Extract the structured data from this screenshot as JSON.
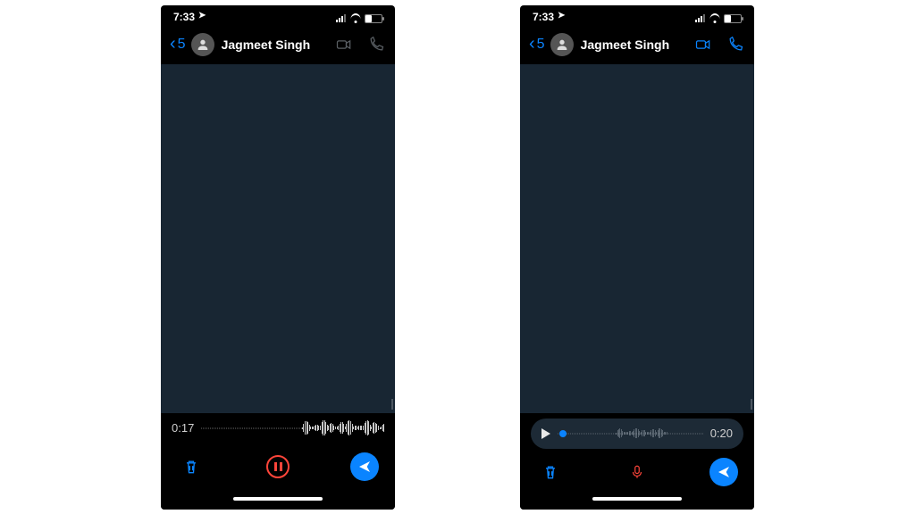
{
  "status": {
    "time": "7:33"
  },
  "header": {
    "back_count": "5",
    "contact_name": "Jagmeet Singh"
  },
  "phoneA": {
    "recording_time": "0:17"
  },
  "phoneB": {
    "recording_time": "0:20"
  },
  "colors": {
    "accent": "#0a84ff",
    "danger": "#ff453a",
    "chat_bg": "#182633"
  }
}
